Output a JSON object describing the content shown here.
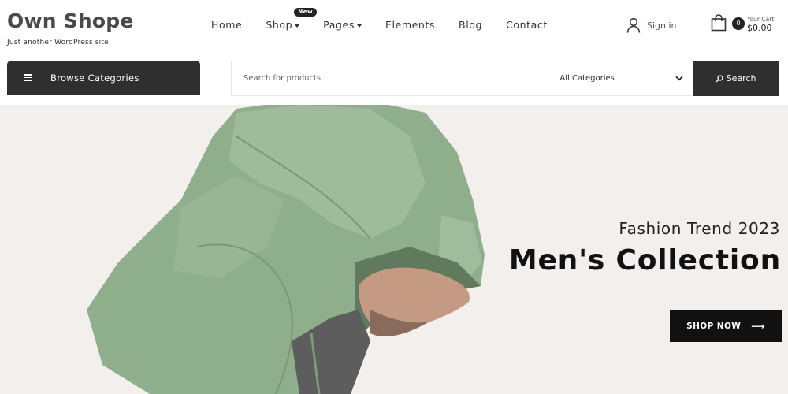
{
  "site": {
    "title": "Own Shope",
    "tagline": "Just another WordPress site"
  },
  "nav": {
    "items": [
      {
        "label": "Home",
        "dropdown": false
      },
      {
        "label": "Shop",
        "dropdown": true,
        "badge": "New"
      },
      {
        "label": "Pages",
        "dropdown": true
      },
      {
        "label": "Elements",
        "dropdown": false
      },
      {
        "label": "Blog",
        "dropdown": false
      },
      {
        "label": "Contact",
        "dropdown": false
      }
    ]
  },
  "account": {
    "signin_label": "Sign in",
    "icon": "user-icon"
  },
  "cart": {
    "icon": "shopping-bag-icon",
    "count": "0",
    "label": "Your Cart",
    "total": "$0.00"
  },
  "categories": {
    "browse_label": "Browse Categories",
    "icon": "hamburger-icon"
  },
  "search": {
    "placeholder": "Search for products",
    "value": "",
    "category_selected": "All Categories",
    "button_label": "Search",
    "button_icon": "search-icon"
  },
  "hero": {
    "subtitle": "Fashion Trend 2023",
    "title": "Men's Collection",
    "cta_label": "SHOP NOW",
    "cta_icon": "arrow-right-icon",
    "image": "man-in-green-hoodie"
  },
  "colors": {
    "dark": "#2f2f2f",
    "hero_bg": "#f3efec",
    "hoodie": "#8fae8c"
  }
}
